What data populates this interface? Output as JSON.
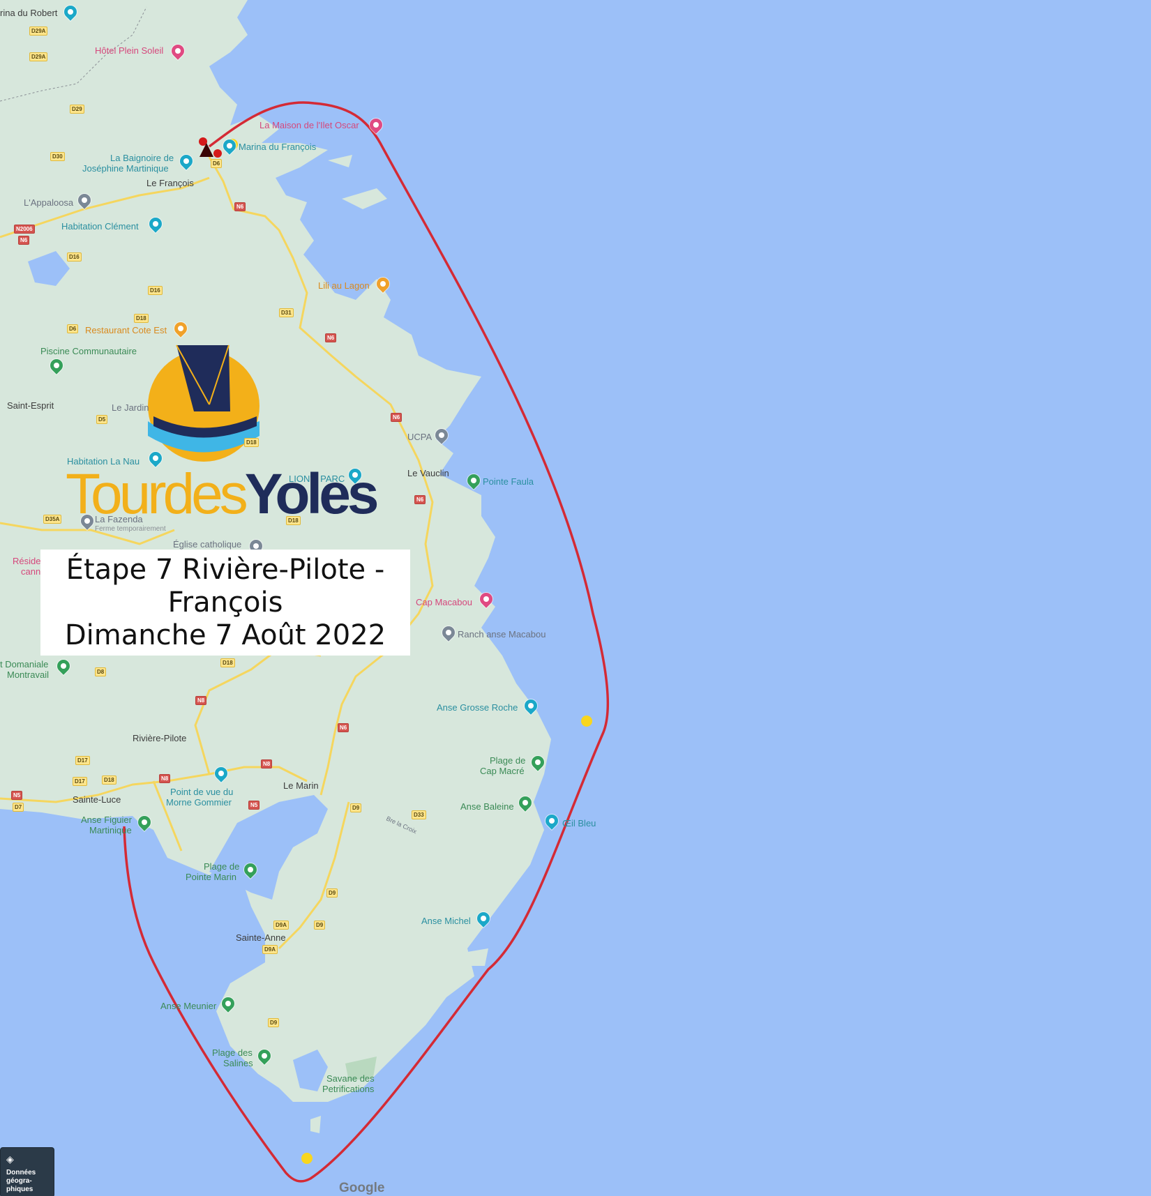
{
  "title": {
    "line1": "Étape 7 Rivière-Pilote -",
    "line2": "François",
    "line3": "Dimanche 7 Août 2022"
  },
  "logo": {
    "part1": "Tourdes",
    "part2": "Yoles"
  },
  "route_color": "#d42a35",
  "land_color": "#d7e7dc",
  "water_color": "#9cc0f8",
  "places": [
    {
      "text": "rina du Robert",
      "cls": "town"
    },
    {
      "text": "Hôtel Plein Soleil",
      "cls": "poi-pink"
    },
    {
      "text": "La Maison de l'Ilet Oscar",
      "cls": "poi-pink"
    },
    {
      "text": "Marina du François",
      "cls": "poi-teal"
    },
    {
      "text": "La Baignoire de",
      "cls": "poi-teal"
    },
    {
      "text": "Joséphine Martinique",
      "cls": "poi-teal"
    },
    {
      "text": "Le François",
      "cls": "town"
    },
    {
      "text": "L'Appaloosa",
      "cls": "poi-gray"
    },
    {
      "text": "Habitation Clément",
      "cls": "poi-teal"
    },
    {
      "text": "Lili au Lagon",
      "cls": "poi-orange"
    },
    {
      "text": "Restaurant Cote Est",
      "cls": "poi-orange"
    },
    {
      "text": "Piscine Communautaire",
      "cls": "poi-green"
    },
    {
      "text": "Saint-Esprit",
      "cls": "town"
    },
    {
      "text": "Le Jardin",
      "cls": "poi-gray"
    },
    {
      "text": "Habitation La Nau",
      "cls": "poi-teal"
    },
    {
      "text": "UCPA",
      "cls": "poi-gray"
    },
    {
      "text": "Le Vauclin",
      "cls": "town"
    },
    {
      "text": "Pointe Faula",
      "cls": "poi-teal"
    },
    {
      "text": "LION'S PARC",
      "cls": "poi-teal"
    },
    {
      "text": "La Fazenda",
      "cls": "poi-gray"
    },
    {
      "text": "Ferme temporairement",
      "cls": "sub"
    },
    {
      "text": "Église catholique",
      "cls": "poi-gray"
    },
    {
      "text": "Réside",
      "cls": "poi-pink"
    },
    {
      "text": "cann",
      "cls": "poi-pink"
    },
    {
      "text": "Cap Macabou",
      "cls": "poi-pink"
    },
    {
      "text": "Ranch anse Macabou",
      "cls": "poi-gray"
    },
    {
      "text": "t Domaniale",
      "cls": "poi-green"
    },
    {
      "text": "Montravail",
      "cls": "poi-green"
    },
    {
      "text": "Anse Grosse Roche",
      "cls": "poi-teal"
    },
    {
      "text": "Rivière-Pilote",
      "cls": "town"
    },
    {
      "text": "Plage de",
      "cls": "poi-green"
    },
    {
      "text": "Cap Macré",
      "cls": "poi-green"
    },
    {
      "text": "Point de vue du",
      "cls": "poi-teal"
    },
    {
      "text": "Morne Gommier",
      "cls": "poi-teal"
    },
    {
      "text": "Le Marin",
      "cls": "town"
    },
    {
      "text": "Sainte-Luce",
      "cls": "town"
    },
    {
      "text": "Anse Baleine",
      "cls": "poi-green"
    },
    {
      "text": "Anse Figuier",
      "cls": "poi-green"
    },
    {
      "text": "Martinique",
      "cls": "poi-green"
    },
    {
      "text": "Bre la Croix",
      "cls": "poi-gray"
    },
    {
      "text": "Œil Bleu",
      "cls": "poi-teal"
    },
    {
      "text": "Plage de",
      "cls": "poi-green"
    },
    {
      "text": "Pointe Marin",
      "cls": "poi-green"
    },
    {
      "text": "Sainte-Anne",
      "cls": "town"
    },
    {
      "text": "Anse Michel",
      "cls": "poi-teal"
    },
    {
      "text": "Anse Meunier",
      "cls": "poi-green"
    },
    {
      "text": "Plage des",
      "cls": "poi-green"
    },
    {
      "text": "Salines",
      "cls": "poi-green"
    },
    {
      "text": "Savane des",
      "cls": "poi-green"
    },
    {
      "text": "Petrifications",
      "cls": "poi-green"
    }
  ],
  "roads": [
    {
      "text": "D29A",
      "type": "d"
    },
    {
      "text": "D29A",
      "type": "d"
    },
    {
      "text": "D29",
      "type": "d"
    },
    {
      "text": "D30",
      "type": "d"
    },
    {
      "text": "D6",
      "type": "d"
    },
    {
      "text": "N6",
      "type": "n"
    },
    {
      "text": "N2006",
      "type": "n"
    },
    {
      "text": "N6",
      "type": "n"
    },
    {
      "text": "D16",
      "type": "d"
    },
    {
      "text": "D16",
      "type": "d"
    },
    {
      "text": "D18",
      "type": "d"
    },
    {
      "text": "D31",
      "type": "d"
    },
    {
      "text": "D6",
      "type": "d"
    },
    {
      "text": "N6",
      "type": "n"
    },
    {
      "text": "D5",
      "type": "d"
    },
    {
      "text": "N6",
      "type": "n"
    },
    {
      "text": "D18",
      "type": "d"
    },
    {
      "text": "N6",
      "type": "n"
    },
    {
      "text": "D35A",
      "type": "d"
    },
    {
      "text": "D18",
      "type": "d"
    },
    {
      "text": "D18",
      "type": "d"
    },
    {
      "text": "D8",
      "type": "d"
    },
    {
      "text": "N8",
      "type": "n"
    },
    {
      "text": "N6",
      "type": "n"
    },
    {
      "text": "D17",
      "type": "d"
    },
    {
      "text": "D17",
      "type": "d"
    },
    {
      "text": "D18",
      "type": "d"
    },
    {
      "text": "N8",
      "type": "n"
    },
    {
      "text": "N8",
      "type": "n"
    },
    {
      "text": "N5",
      "type": "n"
    },
    {
      "text": "D7",
      "type": "d"
    },
    {
      "text": "N5",
      "type": "n"
    },
    {
      "text": "D9",
      "type": "d"
    },
    {
      "text": "D33",
      "type": "d"
    },
    {
      "text": "D9",
      "type": "d"
    },
    {
      "text": "D9A",
      "type": "d"
    },
    {
      "text": "D9",
      "type": "d"
    },
    {
      "text": "D9A",
      "type": "d"
    },
    {
      "text": "D9",
      "type": "d"
    }
  ],
  "layers_button": {
    "label": "Données\ngéogra-\nphiques"
  },
  "attribution": "Google"
}
